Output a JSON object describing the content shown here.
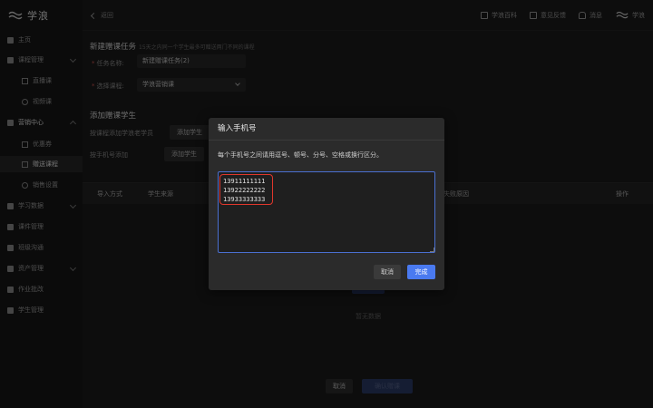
{
  "app": {
    "logo_text": "学浪"
  },
  "sidebar": {
    "items": [
      {
        "label": "主页",
        "icon": "home-icon"
      },
      {
        "label": "课程管理",
        "icon": "book-icon"
      },
      {
        "label": "直播课",
        "icon": "video-icon"
      },
      {
        "label": "视频课",
        "icon": "play-icon"
      },
      {
        "label": "营销中心",
        "icon": "tag-icon"
      },
      {
        "label": "优惠券",
        "icon": "coupon-icon"
      },
      {
        "label": "赠送课程",
        "icon": "gift-icon"
      },
      {
        "label": "销售设置",
        "icon": "gear-icon"
      },
      {
        "label": "学习数据",
        "icon": "chart-icon"
      },
      {
        "label": "课件管理",
        "icon": "folder-icon"
      },
      {
        "label": "班级沟通",
        "icon": "chat-icon"
      },
      {
        "label": "资产管理",
        "icon": "wallet-icon"
      },
      {
        "label": "作业批改",
        "icon": "edit-icon"
      },
      {
        "label": "学生管理",
        "icon": "user-icon"
      }
    ]
  },
  "topbar": {
    "back_label": "返回",
    "links": [
      "学浪百科",
      "意见反馈",
      "消息"
    ],
    "user_name": "学浪"
  },
  "form": {
    "title": "新建赠课任务",
    "title_hint": "15天之内同一个学生最多可赠送两门不同的课程",
    "name_label": "任务名称:",
    "name_value": "新建赠课任务(2)",
    "course_label": "选择课程:",
    "course_value": "学浪营销课",
    "add_section_title": "添加赠课学生",
    "by_course_label": "按课程添加学浪老学员",
    "by_phone_label": "按手机号添加",
    "add_student_btn": "添加学生"
  },
  "table": {
    "columns": [
      "导入方式",
      "学生来源",
      "失败原因",
      "操作"
    ],
    "empty_text": "暂无数据"
  },
  "footer": {
    "cancel": "取消",
    "submit": "确认赠课"
  },
  "modal": {
    "title": "输入手机号",
    "description": "每个手机号之间请用逗号、顿号、分号、空格或换行区分。",
    "phones": "13911111111\n13922222222\n13933333333",
    "cancel": "取消",
    "confirm": "完成"
  },
  "colors": {
    "accent": "#4a7af0",
    "highlight": "#e0372c"
  }
}
